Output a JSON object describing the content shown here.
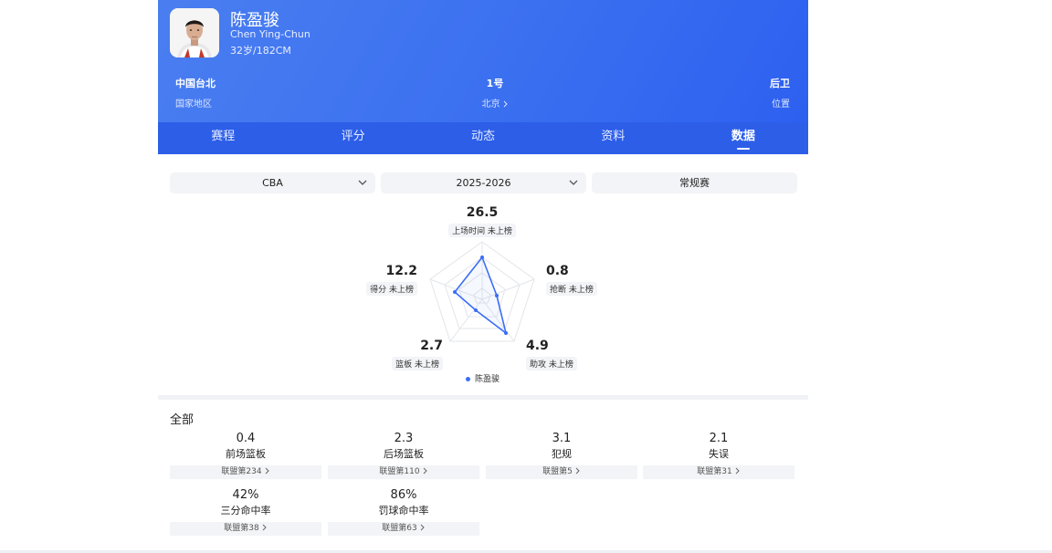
{
  "player": {
    "name": "陈盈骏",
    "english_name": "Chen Ying-Chun",
    "meta": "32岁/182CM",
    "region_value": "中国台北",
    "region_label": "国家地区",
    "number_value": "1号",
    "team_label": "北京",
    "position_value": "后卫",
    "position_label": "位置"
  },
  "tabs": [
    {
      "label": "赛程"
    },
    {
      "label": "评分"
    },
    {
      "label": "动态"
    },
    {
      "label": "资料"
    },
    {
      "label": "数据"
    }
  ],
  "filters": {
    "league": "CBA",
    "season": "2025-2026",
    "stage": "常规赛"
  },
  "radar": {
    "axes": [
      {
        "value": "26.5",
        "label": "上场时间 未上榜"
      },
      {
        "value": "0.8",
        "label": "抢断 未上榜"
      },
      {
        "value": "4.9",
        "label": "助攻 未上榜"
      },
      {
        "value": "2.7",
        "label": "篮板 未上榜"
      },
      {
        "value": "12.2",
        "label": "得分 未上榜"
      }
    ],
    "legend": "陈盈骏",
    "color": "#3b6ef5"
  },
  "stats": {
    "title": "全部",
    "items": [
      {
        "value": "0.4",
        "label": "前场篮板",
        "rank": "联盟第234"
      },
      {
        "value": "2.3",
        "label": "后场篮板",
        "rank": "联盟第110"
      },
      {
        "value": "3.1",
        "label": "犯规",
        "rank": "联盟第5"
      },
      {
        "value": "2.1",
        "label": "失误",
        "rank": "联盟第31"
      },
      {
        "value": "42%",
        "label": "三分命中率",
        "rank": "联盟第38"
      },
      {
        "value": "86%",
        "label": "罚球命中率",
        "rank": "联盟第63"
      }
    ]
  }
}
